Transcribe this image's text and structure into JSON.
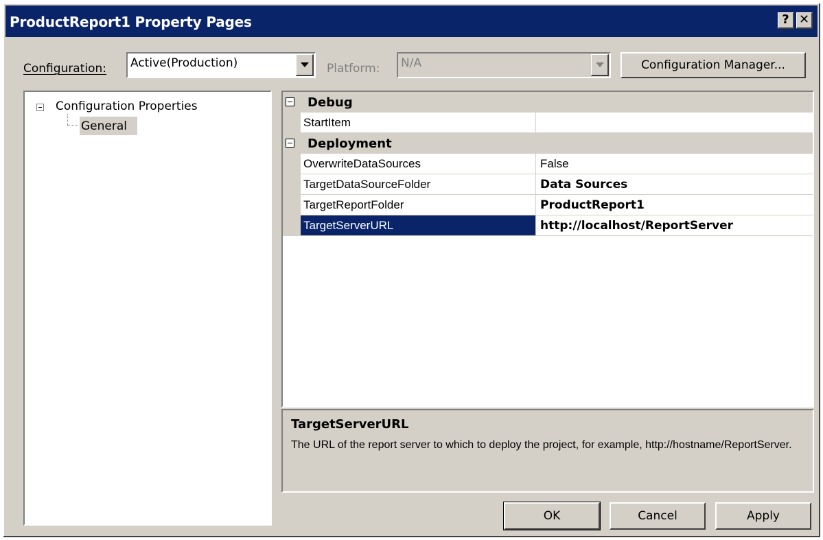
{
  "window": {
    "title": "ProductReport1 Property Pages",
    "help_glyph": "?",
    "close_glyph": "✕"
  },
  "toolbar": {
    "configuration_label": "Configuration:",
    "configuration_value": "Active(Production)",
    "platform_label": "Platform:",
    "platform_value": "N/A",
    "config_manager_label": "Configuration Manager..."
  },
  "tree": {
    "root_label": "Configuration Properties",
    "child_label": "General"
  },
  "grid": {
    "categories": [
      {
        "name": "Debug",
        "properties": [
          {
            "name": "StartItem",
            "value": ""
          }
        ]
      },
      {
        "name": "Deployment",
        "properties": [
          {
            "name": "OverwriteDataSources",
            "value": "False"
          },
          {
            "name": "TargetDataSourceFolder",
            "value": "Data Sources"
          },
          {
            "name": "TargetReportFolder",
            "value": "ProductReport1"
          },
          {
            "name": "TargetServerURL",
            "value": "http://localhost/ReportServer"
          }
        ]
      }
    ]
  },
  "description": {
    "title": "TargetServerURL",
    "text": "The URL of the report server to which to deploy the project, for example, http://hostname/ReportServer."
  },
  "buttons": {
    "ok": "OK",
    "cancel": "Cancel",
    "apply": "Apply"
  },
  "colors": {
    "title_bar": "#0a246a",
    "dialog_face": "#d4d0c8",
    "selection": "#0a246a"
  }
}
